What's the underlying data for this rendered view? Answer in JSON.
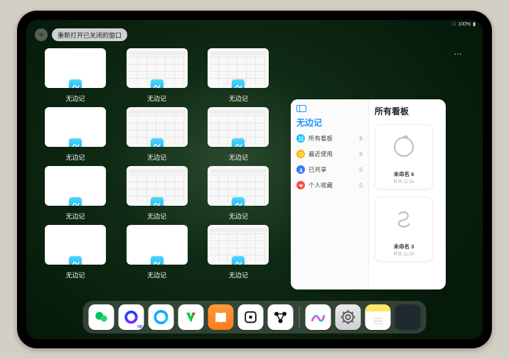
{
  "status": {
    "signal": "􀙇",
    "battery": "100%"
  },
  "topbar": {
    "plus_label": "+",
    "reopen_label": "重新打开已关闭的窗口"
  },
  "app_label": "无边记",
  "windows": [
    {
      "style": "blank"
    },
    {
      "style": "detail"
    },
    {
      "style": "detail"
    },
    {
      "style": "blank"
    },
    {
      "style": "detail"
    },
    {
      "style": "detail"
    },
    {
      "style": "blank"
    },
    {
      "style": "detail"
    },
    {
      "style": "detail"
    },
    {
      "style": "blank"
    },
    {
      "style": "blank"
    },
    {
      "style": "detail"
    }
  ],
  "panel": {
    "left_title": "无边记",
    "right_title": "所有看板",
    "ellipsis": "…",
    "categories": [
      {
        "label": "所有看板",
        "count": 8,
        "color": "#19c3ff"
      },
      {
        "label": "最近使用",
        "count": 8,
        "color": "#ffb400"
      },
      {
        "label": "已共享",
        "count": 0,
        "color": "#2e7bff"
      },
      {
        "label": "个人收藏",
        "count": 0,
        "color": "#ff4b4b"
      }
    ],
    "boards": [
      {
        "name": "未命名 6",
        "sub": "昨天 11:26",
        "digit": "6"
      },
      {
        "name": "未命名 3",
        "sub": "昨天 11:25",
        "digit": "3"
      }
    ]
  },
  "dock": {
    "items": [
      {
        "name": "wechat-app-icon"
      },
      {
        "name": "quark-app-icon"
      },
      {
        "name": "qqbrowser-app-icon"
      },
      {
        "name": "iqiyi-app-icon"
      },
      {
        "name": "books-app-icon"
      },
      {
        "name": "dice-app-icon"
      },
      {
        "name": "nodes-app-icon"
      }
    ],
    "recent": [
      {
        "name": "freeform-app-icon"
      },
      {
        "name": "settings-app-icon"
      },
      {
        "name": "notes-app-icon"
      },
      {
        "name": "app-folder-icon"
      }
    ]
  },
  "colors": {
    "accent": "#1f8fff"
  }
}
